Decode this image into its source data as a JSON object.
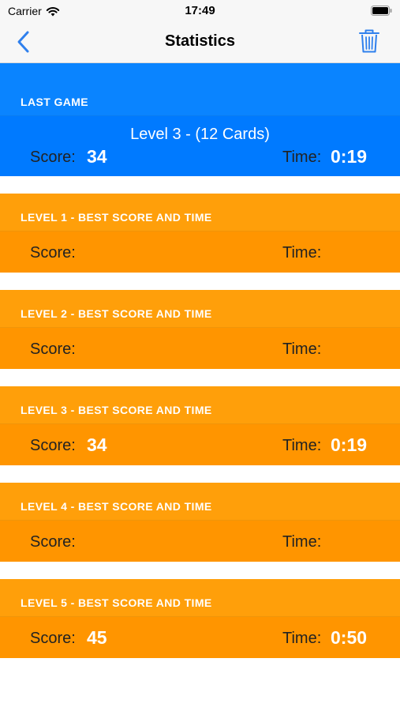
{
  "status_bar": {
    "carrier": "Carrier",
    "time": "17:49"
  },
  "nav": {
    "title": "Statistics",
    "back_icon": "chevron-left-icon",
    "trash_icon": "trash-icon"
  },
  "colors": {
    "last_game_header": "#0a84ff",
    "last_game_row": "#007aff",
    "level_header": "#ff9f0a",
    "level_row": "#ff9500",
    "tint": "#2f80ed"
  },
  "last_game": {
    "header": "LAST GAME",
    "level_title": "Level 3 - (12 Cards)",
    "score_label": "Score:",
    "score": "34",
    "time_label": "Time:",
    "time": "0:19"
  },
  "levels": [
    {
      "header": "LEVEL 1 - BEST SCORE AND TIME",
      "score_label": "Score:",
      "score": "",
      "time_label": "Time:",
      "time": ""
    },
    {
      "header": "LEVEL 2 - BEST SCORE AND TIME",
      "score_label": "Score:",
      "score": "",
      "time_label": "Time:",
      "time": ""
    },
    {
      "header": "LEVEL 3 - BEST SCORE AND TIME",
      "score_label": "Score:",
      "score": "34",
      "time_label": "Time:",
      "time": "0:19"
    },
    {
      "header": "LEVEL 4 - BEST SCORE AND TIME",
      "score_label": "Score:",
      "score": "",
      "time_label": "Time:",
      "time": ""
    },
    {
      "header": "LEVEL 5 - BEST SCORE AND TIME",
      "score_label": "Score:",
      "score": "45",
      "time_label": "Time:",
      "time": "0:50"
    }
  ]
}
